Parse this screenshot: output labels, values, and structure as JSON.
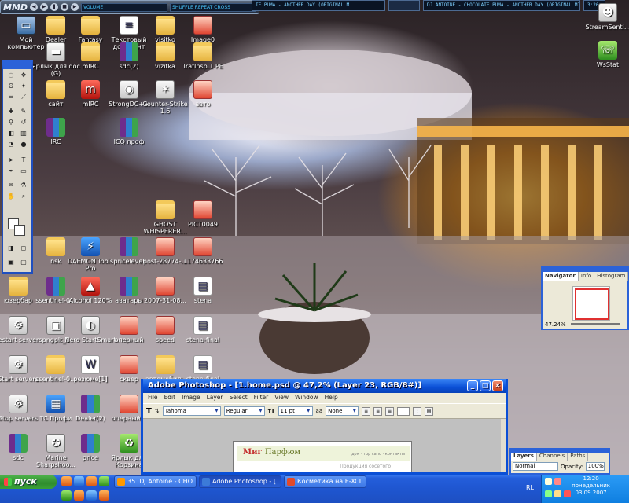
{
  "top_player": {
    "logo": "MMD",
    "lcd_text": "VOLUME",
    "mid_text": "SHUFFLE   REPEAT   CROSS",
    "track_left": "TE PUMA - ANOTHER DAY (ORIGINAL M",
    "track_right": "DJ ANTOINE - CHOCOLATE PUMA - ANOTHER DAY (ORIGINAL MIX)",
    "time": "3:26"
  },
  "desktop_icons": [
    {
      "label": "Мой компьютер",
      "icon": "computer-icon"
    },
    {
      "label": "Dealer",
      "icon": "folder-icon"
    },
    {
      "label": "Fantasy",
      "icon": "folder-icon"
    },
    {
      "label": "Текстовый документ",
      "icon": "text-document-icon"
    },
    {
      "label": "visitko",
      "icon": "folder-icon"
    },
    {
      "label": "Image0",
      "icon": "image-icon"
    },
    {
      "label": "Ярлык для doc (G)",
      "icon": "drive-icon"
    },
    {
      "label": "mIRC",
      "icon": "folder-icon"
    },
    {
      "label": "sdc(2)",
      "icon": "archive-icon"
    },
    {
      "label": "vizitka",
      "icon": "folder-icon"
    },
    {
      "label": "TrafInsp.1 PE",
      "icon": "folder-icon"
    },
    {
      "label": "сайт",
      "icon": "folder-icon"
    },
    {
      "label": "mIRC",
      "icon": "mirc-icon"
    },
    {
      "label": "StrongDC++",
      "icon": "strongdc-icon"
    },
    {
      "label": "Counter-Strike 1.6",
      "icon": "counter-strike-icon"
    },
    {
      "label": "авто",
      "icon": "image-icon"
    },
    {
      "label": "nsk",
      "icon": "folder-icon"
    },
    {
      "label": "DAEMON Tools Pro",
      "icon": "daemon-tools-icon"
    },
    {
      "label": "pricelevel",
      "icon": "archive-icon"
    },
    {
      "label": "post-28774-...",
      "icon": "image-icon"
    },
    {
      "label": "1174633766",
      "icon": "image-icon"
    },
    {
      "label": "юзербар",
      "icon": "folder-icon"
    },
    {
      "label": "ssentinel-0...",
      "icon": "archive-icon"
    },
    {
      "label": "Alcohol 120%",
      "icon": "alcohol-icon"
    },
    {
      "label": "аватары",
      "icon": "archive-icon"
    },
    {
      "label": "2007-31-08...",
      "icon": "image-icon"
    },
    {
      "label": "stena",
      "icon": "image-icon"
    },
    {
      "label": "Restart servers",
      "icon": "batch-icon"
    },
    {
      "label": "pngplt_1",
      "icon": "pngplt-icon"
    },
    {
      "label": "Nero StartSmart",
      "icon": "nero-icon"
    },
    {
      "label": "оперный",
      "icon": "image-icon"
    },
    {
      "label": "speed",
      "icon": "image-icon"
    },
    {
      "label": "stena-final",
      "icon": "image-icon"
    },
    {
      "label": "Start servers",
      "icon": "batch-icon"
    },
    {
      "label": "ssentinel-0...",
      "icon": "folder-icon"
    },
    {
      "label": "резюме[1]",
      "icon": "word-document-icon"
    },
    {
      "label": "сквер",
      "icon": "image-icon"
    },
    {
      "label": "автомобиль",
      "icon": "folder-icon"
    },
    {
      "label": "stena-final",
      "icon": "image-icon"
    },
    {
      "label": "Stop servers",
      "icon": "batch-icon"
    },
    {
      "label": "TC Профи",
      "icon": "tc-profi-icon"
    },
    {
      "label": "Dealer(2)",
      "icon": "archive-icon"
    },
    {
      "label": "оперный 2",
      "icon": "image-icon"
    },
    {
      "label": "sdc",
      "icon": "archive-icon"
    },
    {
      "label": "Marine Sharpshoo...",
      "icon": "game-icon"
    },
    {
      "label": "price",
      "icon": "archive-icon"
    },
    {
      "label": "Ярлык для Корзина",
      "icon": "recycle-bin-icon"
    },
    {
      "label": "StreamSenti...",
      "icon": "streamsentinel-icon"
    },
    {
      "label": "WsStat",
      "icon": "wsstat-icon"
    },
    {
      "label": "IRC",
      "icon": "archive-icon"
    },
    {
      "label": "ICQ проф",
      "icon": "archive-icon"
    },
    {
      "label": "GHOST WHISPERER...",
      "icon": "folder-icon"
    },
    {
      "label": "PICT0049",
      "icon": "image-icon"
    },
    {
      "label": "PICT0049",
      "icon": "image-icon"
    }
  ],
  "photoshop": {
    "title": "Adobe Photoshop - [1.home.psd @ 47,2% (Layer 23, RGB/8#)]",
    "menus": [
      "File",
      "Edit",
      "Image",
      "Layer",
      "Select",
      "Filter",
      "View",
      "Window",
      "Help"
    ],
    "font_family": "Tahoma",
    "font_style": "Regular",
    "font_size": "11 pt",
    "antialias": "None",
    "doc_logo_a": "Миг",
    "doc_logo_b": "Парфюм",
    "doc_nav": "дом · тор сапо · контакты",
    "doc_line2": "Продукция сосетого"
  },
  "navigator": {
    "tabs": [
      "Navigator",
      "Info",
      "Histogram"
    ],
    "zoom": "47.24%"
  },
  "layers": {
    "tabs": [
      "Layers",
      "Channels",
      "Paths"
    ],
    "blend_mode": "Normal",
    "opacity_label": "Opacity:",
    "opacity_value": "100%"
  },
  "taskbar": {
    "start_label": "пуск",
    "tasks": [
      {
        "label": "35. DJ Antoine - CHO..."
      },
      {
        "label": "Adobe Photoshop - [..."
      },
      {
        "label": "Косметика на E-XCL..."
      }
    ],
    "lang": "RL",
    "time": "12:20",
    "day": "понедельник",
    "date": "03.09.2007"
  }
}
